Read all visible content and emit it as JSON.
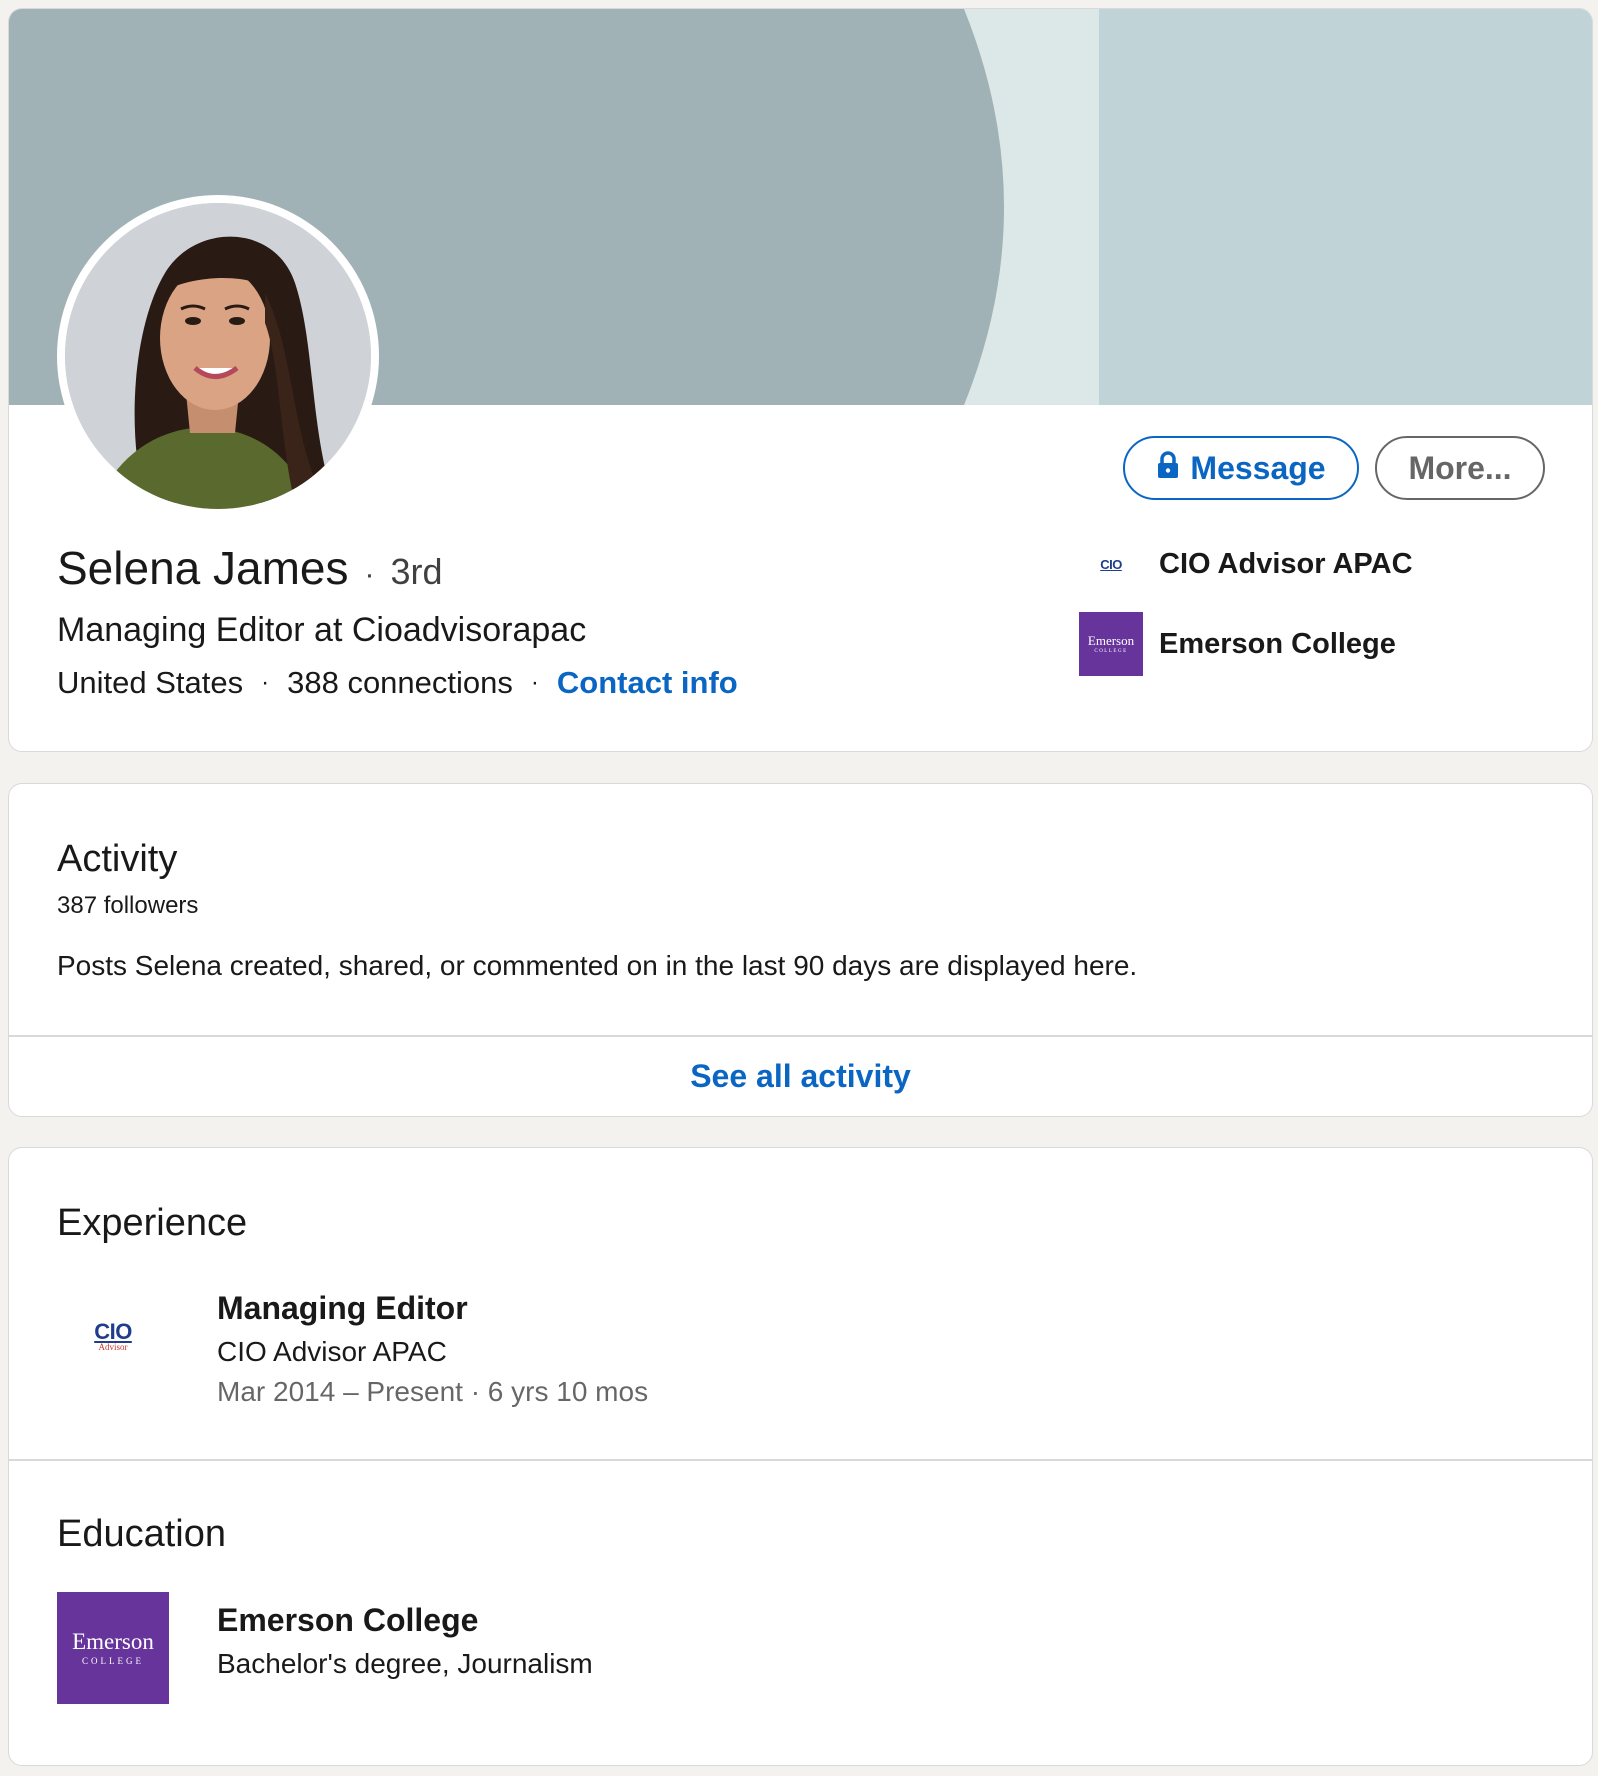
{
  "profile": {
    "name": "Selena James",
    "degree_separator": "·",
    "degree": "3rd",
    "headline": "Managing Editor at Cioadvisorapac",
    "location": "United States",
    "meta_separator": "·",
    "connections": "388 connections",
    "contact_info": "Contact info",
    "message_button": "Message",
    "more_button": "More...",
    "current_company": "CIO Advisor APAC",
    "school": "Emerson College",
    "avatar_icon": "profile-photo"
  },
  "logos": {
    "cio_main": "CIO",
    "cio_sub": "Advisor",
    "emerson_main": "Emerson",
    "emerson_sub": "COLLEGE"
  },
  "activity": {
    "title": "Activity",
    "followers": "387 followers",
    "description": "Posts Selena created, shared, or commented on in the last 90 days are displayed here.",
    "see_all": "See all activity"
  },
  "experience": {
    "title": "Experience",
    "items": [
      {
        "title": "Managing Editor",
        "company": "CIO Advisor APAC",
        "dates": "Mar 2014 – Present · 6 yrs 10 mos"
      }
    ]
  },
  "education": {
    "title": "Education",
    "items": [
      {
        "school": "Emerson College",
        "degree": "Bachelor's degree, Journalism"
      }
    ]
  },
  "colors": {
    "accent": "#0a66c2",
    "cover_dark": "#a0b2b5",
    "cover_light": "#c0d4d7",
    "emerson_purple": "#66349a",
    "background": "#f3f2ef"
  }
}
